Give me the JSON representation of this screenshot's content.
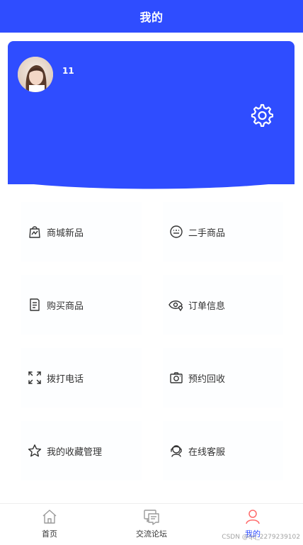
{
  "header": {
    "title": "我的"
  },
  "profile": {
    "username": "11",
    "avatar_icon": "avatar-photo",
    "settings_icon": "gear-icon",
    "card_color": "#2f4dff"
  },
  "menu": {
    "items": [
      {
        "label": "商城新品",
        "icon": "shopping-bag-icon"
      },
      {
        "label": "二手商品",
        "icon": "keyboard-icon"
      },
      {
        "label": "购买商品",
        "icon": "document-list-icon"
      },
      {
        "label": "订单信息",
        "icon": "eye-location-icon"
      },
      {
        "label": "拨打电话",
        "icon": "fullscreen-icon"
      },
      {
        "label": "预约回收",
        "icon": "camera-icon"
      },
      {
        "label": "我的收藏管理",
        "icon": "star-icon"
      },
      {
        "label": "在线客服",
        "icon": "customer-service-icon"
      }
    ]
  },
  "tabbar": {
    "tabs": [
      {
        "label": "首页",
        "icon": "home-icon"
      },
      {
        "label": "交流论坛",
        "icon": "forum-icon"
      },
      {
        "label": "我的",
        "icon": "person-icon",
        "active": true
      }
    ]
  },
  "watermark": {
    "text": "CSDN @qq_2279239102"
  },
  "colors": {
    "primary": "#2f4dff",
    "active_tab_icon": "#ff6b6b",
    "text": "#333333"
  }
}
